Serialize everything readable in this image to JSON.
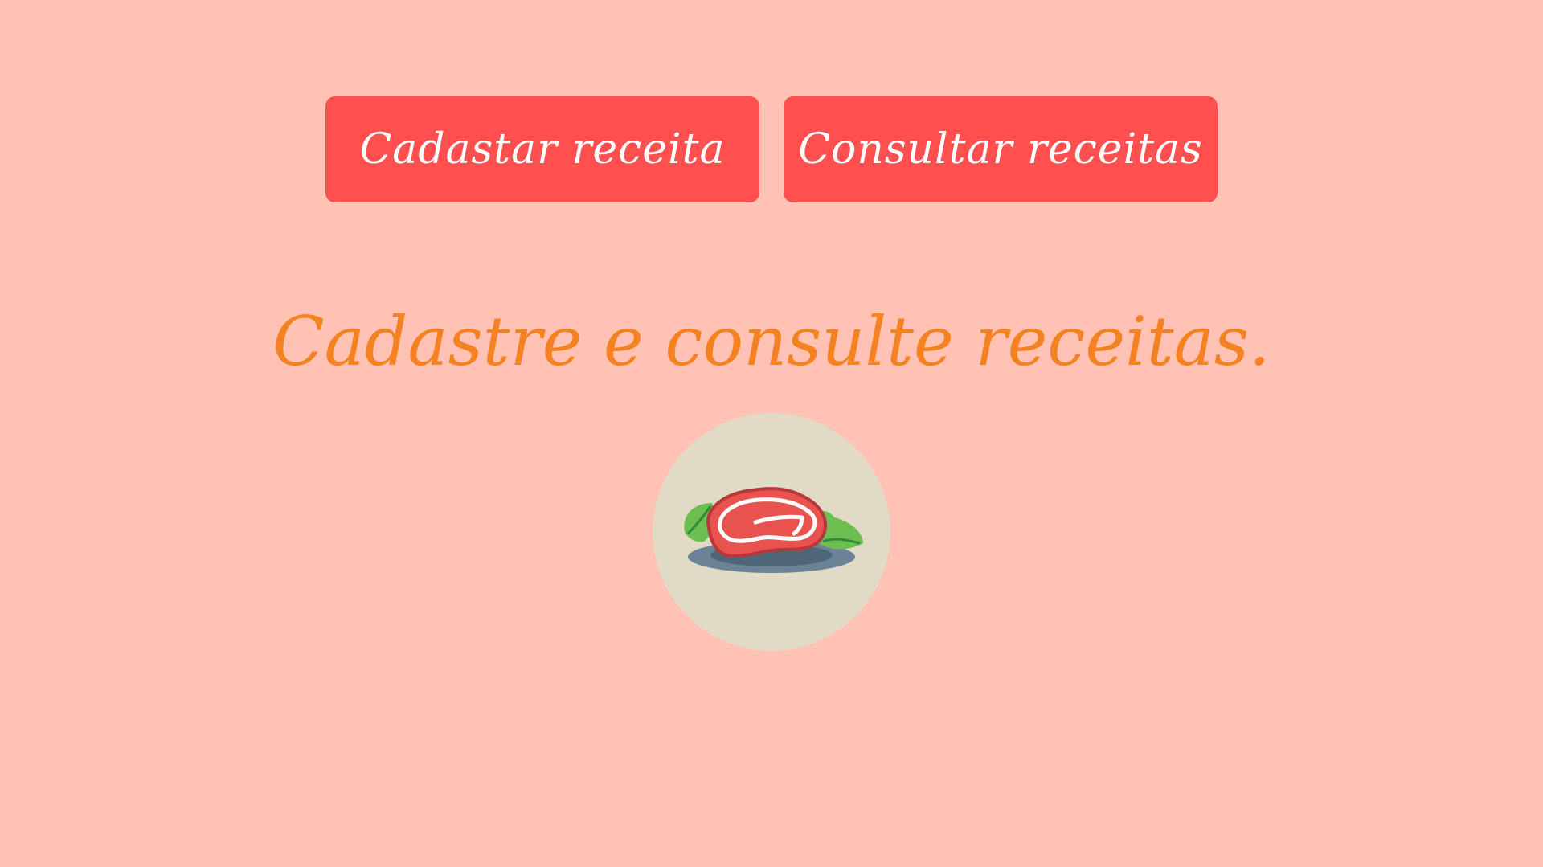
{
  "colors": {
    "background": "#FFC2B4",
    "button_bg": "#FF4F4F",
    "button_text": "#FFFFFF",
    "headline": "#F58220",
    "circle": "#E1DAC4",
    "meat": "#E8534F",
    "meat_outline": "#B8373B",
    "plate": "#6B8396",
    "plate_dark": "#4E6678",
    "leaf": "#6BBE4F",
    "leaf_dark": "#2E8B3A"
  },
  "nav": {
    "buttons": [
      {
        "label": "Cadastar receita"
      },
      {
        "label": "Consultar receitas"
      }
    ]
  },
  "main": {
    "headline": "Cadastre e consulte receitas.",
    "illustration_icon": "steak-on-plate-icon"
  }
}
